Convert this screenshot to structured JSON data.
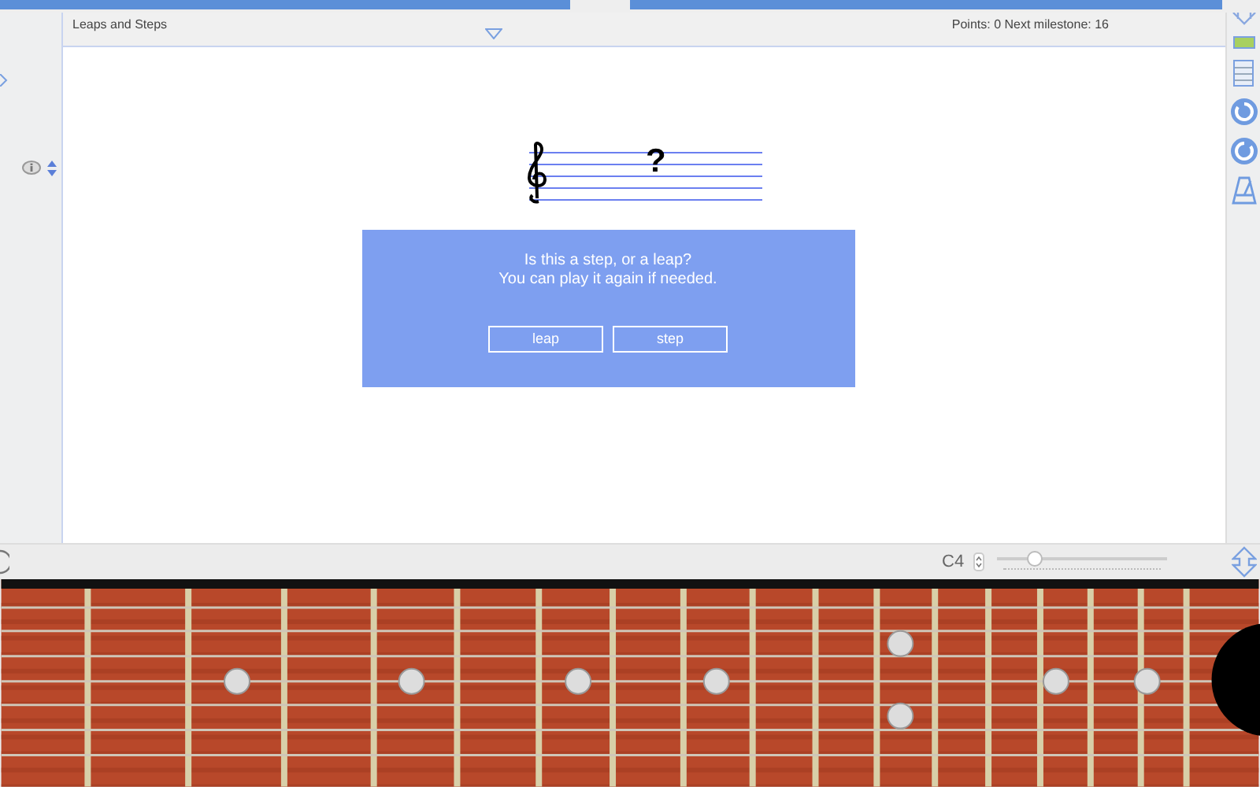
{
  "header": {
    "title": "Leaps and Steps",
    "score": "Points: 0 Next milestone: 16"
  },
  "staff": {
    "symbol": "?"
  },
  "question": {
    "lines": [
      "Is this a step, or a leap?",
      "You can play it again if needed."
    ],
    "buttons": [
      "leap",
      "step"
    ]
  },
  "bottom_bar": {
    "note": "C4",
    "slider": {
      "level": 0.22
    }
  }
}
